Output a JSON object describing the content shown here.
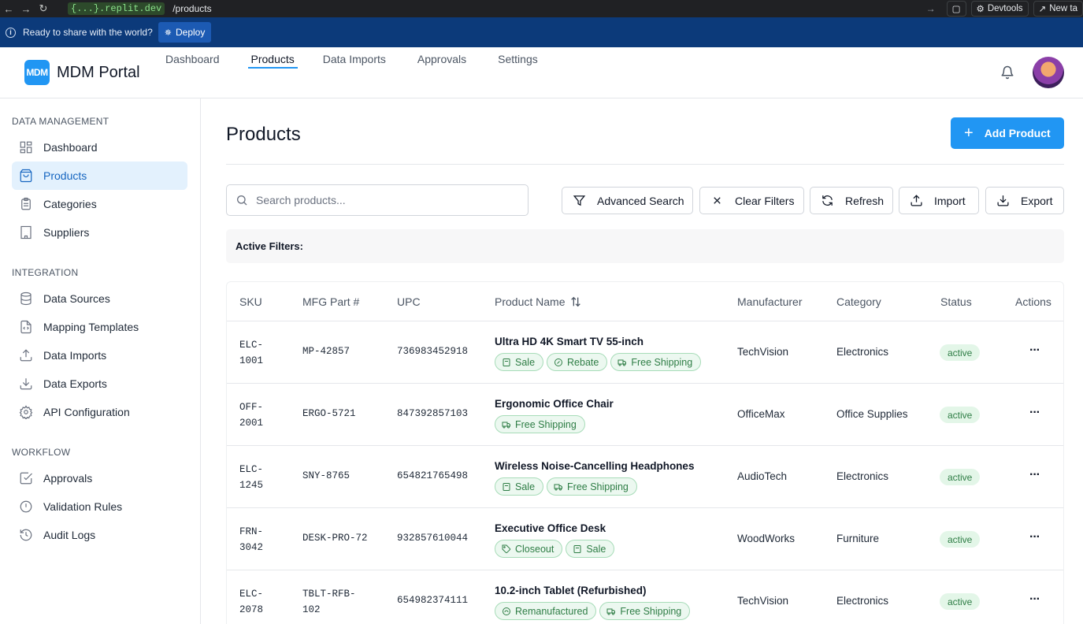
{
  "browser": {
    "url_host": "{...}.replit.dev",
    "url_path": "/products",
    "devtools_label": "Devtools",
    "newtab_label": "New ta"
  },
  "deploy": {
    "message": "Ready to share with the world?",
    "button": "Deploy"
  },
  "app": {
    "logo": "MDM",
    "title": "MDM Portal"
  },
  "topnav": [
    "Dashboard",
    "Products",
    "Data Imports",
    "Approvals",
    "Settings"
  ],
  "sidebar": {
    "sections": [
      {
        "heading": "DATA MANAGEMENT",
        "items": [
          "Dashboard",
          "Products",
          "Categories",
          "Suppliers"
        ]
      },
      {
        "heading": "INTEGRATION",
        "items": [
          "Data Sources",
          "Mapping Templates",
          "Data Imports",
          "Data Exports",
          "API Configuration"
        ]
      },
      {
        "heading": "WORKFLOW",
        "items": [
          "Approvals",
          "Validation Rules",
          "Audit Logs"
        ]
      }
    ]
  },
  "main": {
    "title": "Products",
    "add_button": "Add Product",
    "search_placeholder": "Search products...",
    "toolbar": [
      "Advanced Search",
      "Clear Filters",
      "Refresh",
      "Import",
      "Export"
    ],
    "active_filters_label": "Active Filters:"
  },
  "table": {
    "headers": [
      "SKU",
      "MFG Part #",
      "UPC",
      "Product Name",
      "Manufacturer",
      "Category",
      "Status",
      "Actions"
    ],
    "rows": [
      {
        "sku": [
          "ELC-",
          "1001"
        ],
        "mfg": "MP-42857",
        "upc": "736983452918",
        "name": "Ultra HD 4K Smart TV 55-inch",
        "tags": [
          "Sale",
          "Rebate",
          "Free Shipping"
        ],
        "manufacturer": "TechVision",
        "category": "Electronics",
        "status": "active"
      },
      {
        "sku": [
          "OFF-",
          "2001"
        ],
        "mfg": "ERGO-5721",
        "upc": "847392857103",
        "name": "Ergonomic Office Chair",
        "tags": [
          "Free Shipping"
        ],
        "manufacturer": "OfficeMax",
        "category": "Office Supplies",
        "status": "active"
      },
      {
        "sku": [
          "ELC-",
          "1245"
        ],
        "mfg": "SNY-8765",
        "upc": "654821765498",
        "name": "Wireless Noise-Cancelling Headphones",
        "tags": [
          "Sale",
          "Free Shipping"
        ],
        "manufacturer": "AudioTech",
        "category": "Electronics",
        "status": "active"
      },
      {
        "sku": [
          "FRN-",
          "3042"
        ],
        "mfg": "DESK-PRO-72",
        "upc": "932857610044",
        "name": "Executive Office Desk",
        "tags": [
          "Closeout",
          "Sale"
        ],
        "manufacturer": "WoodWorks",
        "category": "Furniture",
        "status": "active"
      },
      {
        "sku": [
          "ELC-",
          "2078"
        ],
        "mfg": [
          "TBLT-RFB-",
          "102"
        ],
        "upc": "654982374111",
        "name": "10.2-inch Tablet (Refurbished)",
        "tags": [
          "Remanufactured",
          "Free Shipping"
        ],
        "manufacturer": "TechVision",
        "category": "Electronics",
        "status": "active"
      }
    ]
  }
}
